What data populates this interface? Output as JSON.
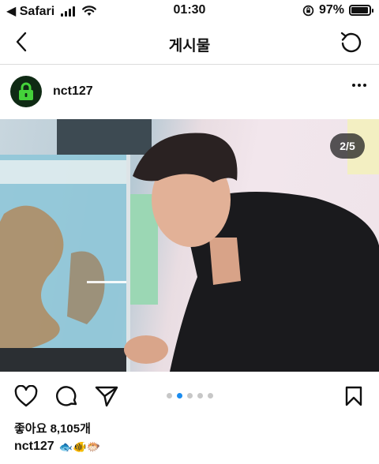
{
  "status_bar": {
    "back_app": "◀ Safari",
    "time": "01:30",
    "battery_percent_text": "97%",
    "battery_level": 0.97
  },
  "nav": {
    "title": "게시물",
    "back_icon": "chevron-left-icon",
    "refresh_icon": "refresh-icon"
  },
  "post": {
    "username": "nct127",
    "avatar_icon": "green-lock-icon",
    "page_indicator": "2/5",
    "carousel_pages": 5,
    "carousel_current": 2,
    "likes": "좋아요 8,105개",
    "caption_user": "nct127",
    "caption_text": "🐟🐠🐡",
    "comments_hint": "···· ··"
  },
  "colors": {
    "accent_dot": "#1a8cf0",
    "text": "#111111",
    "divider": "#dbdbdb"
  }
}
